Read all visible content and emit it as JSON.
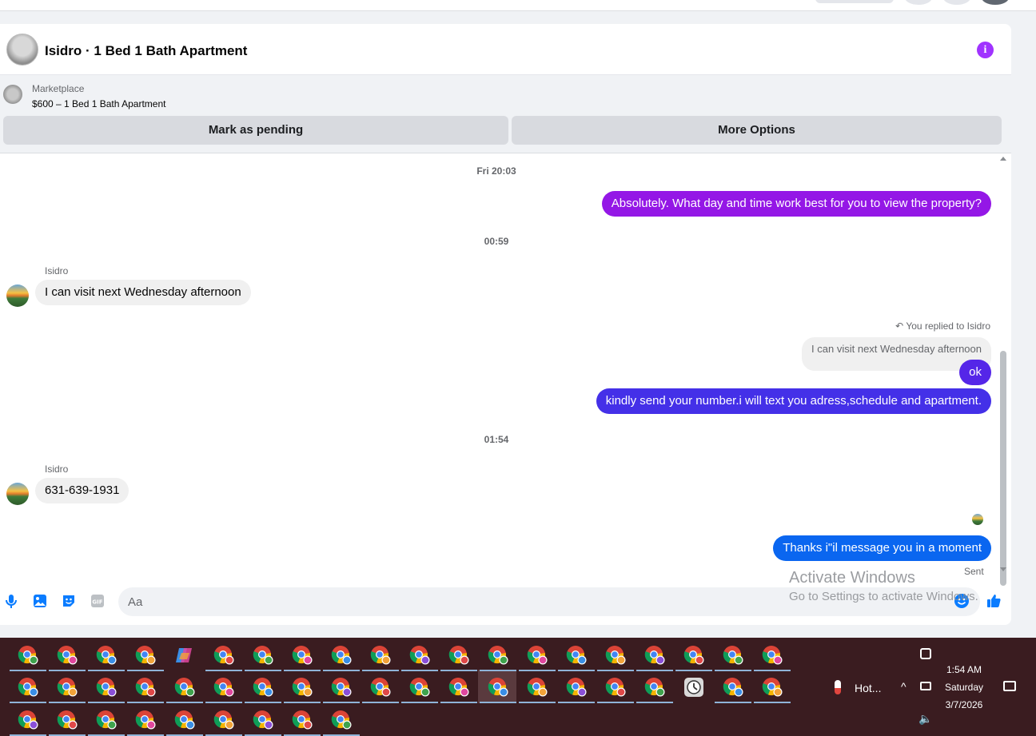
{
  "conversation": {
    "title": "Isidro · 1 Bed 1 Bath Apartment"
  },
  "marketplace": {
    "label": "Marketplace",
    "item": "$600 – 1 Bed 1 Bath Apartment",
    "mark_pending": "Mark as pending",
    "more_options": "More Options"
  },
  "messages": {
    "ts1": "Fri 20:03",
    "m1": "Absolutely. What day and time work best for you to view the property?",
    "ts2": "00:59",
    "sender1": "Isidro",
    "m2": "I can visit next Wednesday afternoon",
    "reply_header": "You replied to Isidro",
    "quoted": "I can visit next Wednesday afternoon",
    "m3": "ok",
    "m4": "kindly send your number.i will text you adress,schedule and apartment.",
    "ts3": "01:54",
    "sender2": "Isidro",
    "m5": "631-639-1931",
    "m6": "Thanks i\"il message you in a moment",
    "sent_status": "Sent"
  },
  "composer": {
    "placeholder": "Aa",
    "icons": [
      "microphone-icon",
      "image-icon",
      "sticker-icon",
      "gif-icon",
      "emoji-icon",
      "thumbs-up-icon"
    ]
  },
  "watermark": {
    "line1": "Activate Windows",
    "line2": "Go to Settings to activate Windows."
  },
  "taskbar": {
    "weather": "Hot...",
    "time": "1:54 AM",
    "day": "Saturday",
    "date": "3/7/2026"
  },
  "colors": {
    "purple_bubble": "#9417e6",
    "indigo_bubble": "#4430e8",
    "blue_bubble": "#0a66f0",
    "info_icon": "#a033ff",
    "composer_icons": "#0a7cff",
    "taskbar": "#3a1c20"
  }
}
